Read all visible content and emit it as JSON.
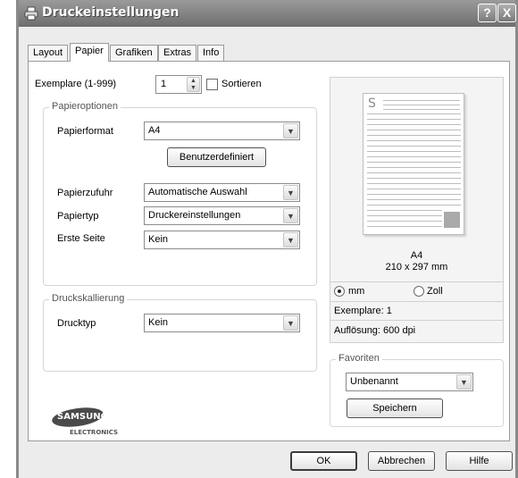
{
  "window": {
    "title": "Druckeinstellungen",
    "help_button": "?",
    "close_button": "X"
  },
  "tabs": [
    {
      "label": "Layout",
      "active": false
    },
    {
      "label": "Papier",
      "active": true
    },
    {
      "label": "Grafiken",
      "active": false
    },
    {
      "label": "Extras",
      "active": false
    },
    {
      "label": "Info",
      "active": false
    }
  ],
  "copies": {
    "label": "Exemplare (1-999)",
    "value": "1",
    "sort_label": "Sortieren",
    "sort_checked": false
  },
  "paper_options": {
    "group_title": "Papieroptionen",
    "format_label": "Papierformat",
    "format_value": "A4",
    "custom_button": "Benutzerdefiniert",
    "feed_label": "Papierzufuhr",
    "feed_value": "Automatische Auswahl",
    "type_label": "Papiertyp",
    "type_value": "Druckereinstellungen",
    "first_page_label": "Erste Seite",
    "first_page_value": "Kein"
  },
  "scaling": {
    "group_title": "Druckskallierung",
    "type_label": "Drucktyp",
    "type_value": "Kein"
  },
  "preview": {
    "page_glyph": "S",
    "paper_name": "A4",
    "paper_size": "210 x 297 mm",
    "unit_mm_label": "mm",
    "unit_zoll_label": "Zoll",
    "unit_selected": "mm",
    "copies_info": "Exemplare: 1",
    "resolution_info": "Auflösung: 600 dpi"
  },
  "favorites": {
    "group_title": "Favoriten",
    "value": "Unbenannt",
    "save_button": "Speichern"
  },
  "logo": {
    "brand": "SAMSUNG",
    "sub": "ELECTRONICS"
  },
  "footer": {
    "ok": "OK",
    "cancel": "Abbrechen",
    "help": "Hilfe"
  },
  "icons": {
    "app": "printer-icon",
    "dropdown": "chevron-down-icon",
    "spinner": "spinner-arrows-icon"
  }
}
